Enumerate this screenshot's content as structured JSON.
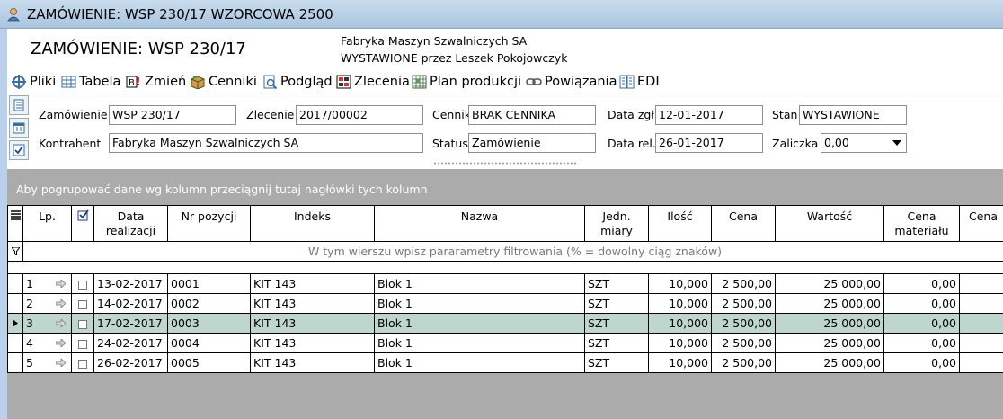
{
  "window": {
    "title": "ZAMÓWIENIE: WSP 230/17 WZORCOWA 2500"
  },
  "header": {
    "doc_title": "ZAMÓWIENIE: WSP 230/17",
    "company": "Fabryka Maszyn Szwalniczych SA",
    "issued_by": "WYSTAWIONE przez Leszek Pokojowczyk"
  },
  "toolbar": {
    "items": [
      {
        "label": "Pliki",
        "icon": "files-icon"
      },
      {
        "label": "Tabela",
        "icon": "table-icon"
      },
      {
        "label": "Zmień",
        "icon": "change-icon"
      },
      {
        "label": "Cenniki",
        "icon": "pricelist-icon"
      },
      {
        "label": "Podgląd",
        "icon": "preview-icon"
      },
      {
        "label": "Zlecenia",
        "icon": "orders-icon"
      },
      {
        "label": "Plan produkcji",
        "icon": "production-plan-icon"
      },
      {
        "label": "Powiązania",
        "icon": "link-icon"
      },
      {
        "label": "EDI",
        "icon": "edi-icon"
      }
    ]
  },
  "form": {
    "zamowienie_label": "Zamówienie",
    "zamowienie_value": "WSP 230/17",
    "zlecenie_label": "Zlecenie",
    "zlecenie_value": "2017/00002",
    "cennik_label": "Cennik",
    "cennik_value": "BRAK CENNIKA",
    "data_zgl_label": "Data zgł.",
    "data_zgl_value": "12-01-2017",
    "stan_label": "Stan",
    "stan_value": "WYSTAWIONE",
    "kontrahent_label": "Kontrahent",
    "kontrahent_value": "Fabryka Maszyn Szwalniczych SA",
    "status_label": "Status",
    "status_value": "Zamówienie",
    "data_rel_label": "Data rel.",
    "data_rel_value": "26-01-2017",
    "zaliczka_label": "Zaliczka",
    "zaliczka_value": "0,00"
  },
  "grid": {
    "group_hint": "Aby pogrupować dane wg kolumn przeciągnij tutaj nagłówki tych kolumn",
    "filter_hint": "W tym wierszu wpisz pararametry filtrowania (% = dowolny ciąg znaków)",
    "columns": [
      "Lp.",
      "Data realizacji",
      "Nr pozycji",
      "Indeks",
      "Nazwa",
      "Jedn. miary",
      "Ilość",
      "Cena",
      "Wartość",
      "Cena materiału",
      "Cena"
    ],
    "rows": [
      {
        "lp": "1",
        "data": "13-02-2017",
        "nr": "0001",
        "indeks": "KIT 143",
        "nazwa": "Blok 1",
        "jm": "SZT",
        "ilosc": "10,000",
        "cena": "2 500,00",
        "wartosc": "25 000,00",
        "cena_mat": "0,00"
      },
      {
        "lp": "2",
        "data": "14-02-2017",
        "nr": "0002",
        "indeks": "KIT 143",
        "nazwa": "Blok 1",
        "jm": "SZT",
        "ilosc": "10,000",
        "cena": "2 500,00",
        "wartosc": "25 000,00",
        "cena_mat": "0,00"
      },
      {
        "lp": "3",
        "data": "17-02-2017",
        "nr": "0003",
        "indeks": "KIT 143",
        "nazwa": "Blok 1",
        "jm": "SZT",
        "ilosc": "10,000",
        "cena": "2 500,00",
        "wartosc": "25 000,00",
        "cena_mat": "0,00"
      },
      {
        "lp": "4",
        "data": "24-02-2017",
        "nr": "0004",
        "indeks": "KIT 143",
        "nazwa": "Blok 1",
        "jm": "SZT",
        "ilosc": "10,000",
        "cena": "2 500,00",
        "wartosc": "25 000,00",
        "cena_mat": "0,00"
      },
      {
        "lp": "5",
        "data": "26-02-2017",
        "nr": "0005",
        "indeks": "KIT 143",
        "nazwa": "Blok 1",
        "jm": "SZT",
        "ilosc": "10,000",
        "cena": "2 500,00",
        "wartosc": "25 000,00",
        "cena_mat": "0,00"
      }
    ],
    "selected_row_color": "#bfd6d0"
  }
}
